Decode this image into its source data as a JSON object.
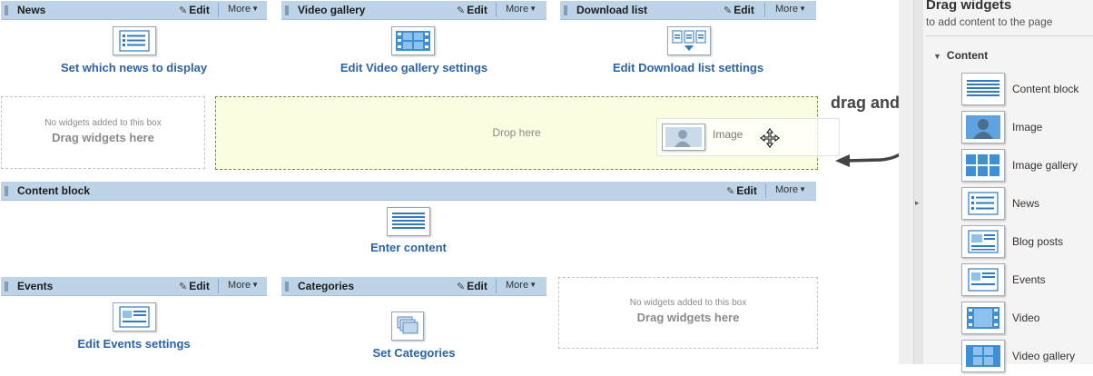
{
  "common": {
    "edit_label": "Edit",
    "more_label": "More"
  },
  "widgets": {
    "news": {
      "title": "News",
      "link": "Set which news to display"
    },
    "video_gallery": {
      "title": "Video gallery",
      "link": "Edit Video gallery settings"
    },
    "download_list": {
      "title": "Download list",
      "link": "Edit Download list settings"
    },
    "content_block": {
      "title": "Content block",
      "link": "Enter content"
    },
    "events": {
      "title": "Events",
      "link": "Edit Events settings"
    },
    "categories": {
      "title": "Categories",
      "link": "Set Categories"
    }
  },
  "empty_box": {
    "small_text": "No widgets added to this box",
    "big_text": "Drag widgets here"
  },
  "drop_zone": {
    "text": "Drop here"
  },
  "dragging": {
    "label": "Image"
  },
  "annotation": {
    "text": "drag and drop"
  },
  "panel": {
    "title": "Drag widgets",
    "subtitle": "to add content to the page",
    "group": "Content",
    "items": [
      {
        "label": "Content block",
        "icon": "content-block-icon"
      },
      {
        "label": "Image",
        "icon": "image-icon"
      },
      {
        "label": "Image gallery",
        "icon": "image-gallery-icon"
      },
      {
        "label": "News",
        "icon": "news-icon"
      },
      {
        "label": "Blog posts",
        "icon": "blog-posts-icon"
      },
      {
        "label": "Events",
        "icon": "events-icon"
      },
      {
        "label": "Video",
        "icon": "video-icon"
      },
      {
        "label": "Video gallery",
        "icon": "video-gallery-icon"
      }
    ]
  },
  "colors": {
    "header": "#bcd3e8",
    "link": "#2a63a8",
    "drop_zone": "#fbfde0"
  }
}
